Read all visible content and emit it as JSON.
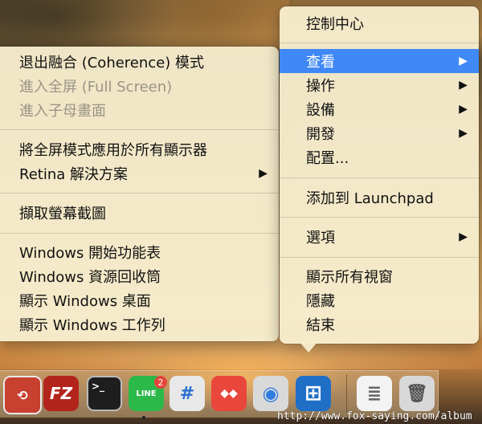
{
  "right_menu": {
    "items": [
      {
        "label": "控制中心",
        "submenu": false
      },
      {
        "label": "查看",
        "submenu": true,
        "highlight": true
      },
      {
        "label": "操作",
        "submenu": true
      },
      {
        "label": "設備",
        "submenu": true
      },
      {
        "label": "開發",
        "submenu": true
      },
      {
        "label": "配置...",
        "submenu": false
      },
      {
        "label": "添加到 Launchpad",
        "submenu": false
      },
      {
        "label": "選項",
        "submenu": true
      },
      {
        "label": "顯示所有視窗",
        "submenu": false
      },
      {
        "label": "隱藏",
        "submenu": false
      },
      {
        "label": "結束",
        "submenu": false
      }
    ],
    "arrow": "▶"
  },
  "left_menu": {
    "items": [
      {
        "label": "退出融合 (Coherence) 模式",
        "enabled": true
      },
      {
        "label": "進入全屏 (Full Screen)",
        "enabled": false
      },
      {
        "label": "進入子母畫面",
        "enabled": false
      },
      {
        "label": "將全屏模式應用於所有顯示器",
        "enabled": true
      },
      {
        "label": "Retina 解決方案",
        "enabled": true,
        "submenu": true
      },
      {
        "label": "擷取螢幕截圖",
        "enabled": true
      },
      {
        "label": "Windows 開始功能表",
        "enabled": true
      },
      {
        "label": "Windows 資源回收筒",
        "enabled": true
      },
      {
        "label": "顯示 Windows 桌面",
        "enabled": true
      },
      {
        "label": "顯示 Windows 工作列",
        "enabled": true
      }
    ],
    "arrow": "▶"
  },
  "dock": {
    "icons": [
      {
        "name": "remote-desktop-icon",
        "glyph": "⟲"
      },
      {
        "name": "filezilla-icon",
        "glyph": "FZ"
      },
      {
        "name": "terminal-icon",
        "glyph": ">_"
      },
      {
        "name": "line-icon",
        "glyph": "LINE"
      },
      {
        "name": "hashtag-app-icon",
        "glyph": "#"
      },
      {
        "name": "anydesk-icon",
        "glyph": "◆◆"
      },
      {
        "name": "chrome-parallels-icon",
        "glyph": "◉"
      },
      {
        "name": "windows-icon",
        "glyph": "⊞"
      },
      {
        "name": "document-stack-icon",
        "glyph": "≣"
      },
      {
        "name": "trash-icon",
        "glyph": "🗑"
      }
    ],
    "line_badge": "2"
  },
  "watermark": "http://www.fox-saying.com/album"
}
